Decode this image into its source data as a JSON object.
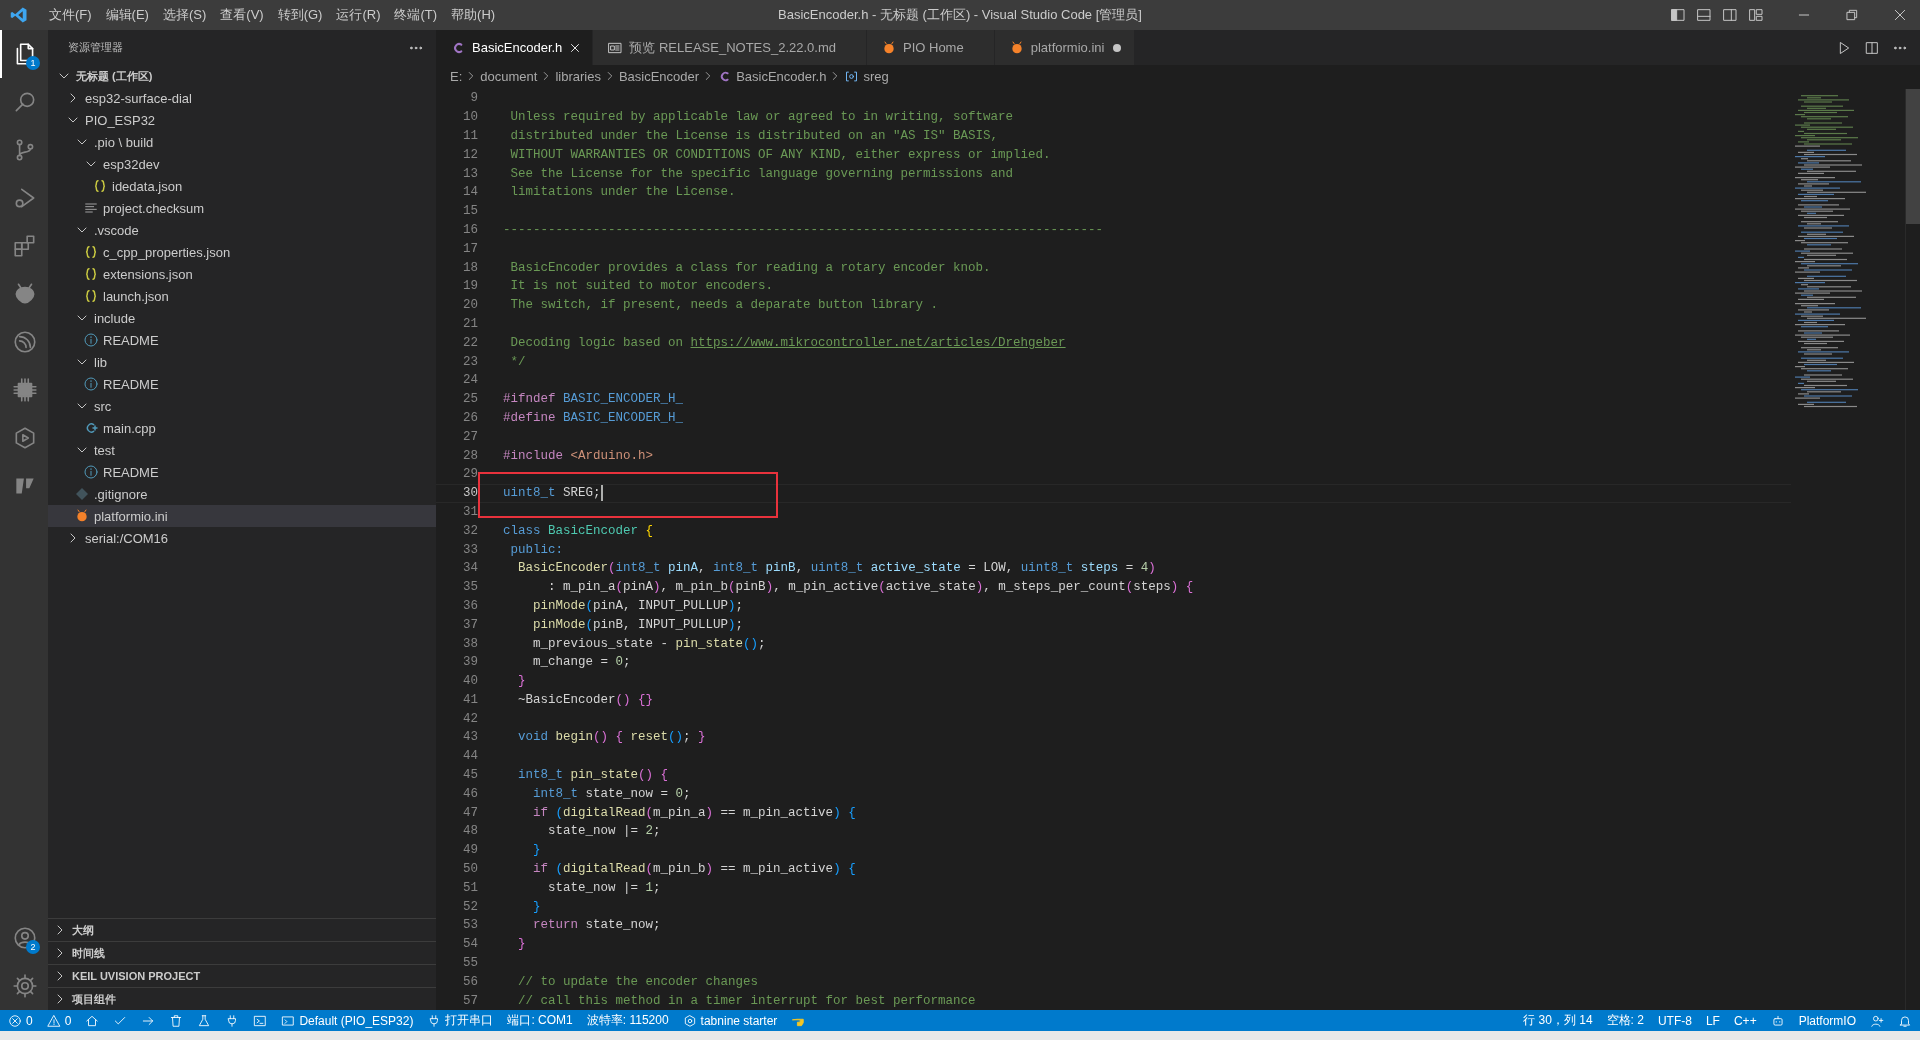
{
  "window": {
    "title": "BasicEncoder.h - 无标题 (工作区) - Visual Studio Code [管理员]",
    "menu": [
      "文件(F)",
      "编辑(E)",
      "选择(S)",
      "查看(V)",
      "转到(G)",
      "运行(R)",
      "终端(T)",
      "帮助(H)"
    ],
    "controls": [
      {
        "kind": "layout_left"
      },
      {
        "kind": "layout_panel"
      },
      {
        "kind": "layout_right"
      },
      {
        "kind": "layout_custom"
      },
      {
        "kind": "minimize"
      },
      {
        "kind": "restore"
      },
      {
        "kind": "close_win"
      }
    ]
  },
  "activity_bar": {
    "items": [
      {
        "kind": "files",
        "badge": "1",
        "selected": true
      },
      {
        "kind": "search",
        "selected": false
      },
      {
        "kind": "scm",
        "selected": false
      },
      {
        "kind": "debug",
        "selected": false
      },
      {
        "kind": "extensions",
        "selected": false
      },
      {
        "kind": "alien",
        "selected": false
      },
      {
        "kind": "espressif",
        "selected": false
      },
      {
        "kind": "chip",
        "selected": false
      },
      {
        "kind": "hexplay",
        "selected": false
      },
      {
        "kind": "flag",
        "selected": false
      }
    ],
    "bottom": [
      {
        "kind": "account",
        "badge": "2"
      },
      {
        "kind": "gear"
      }
    ]
  },
  "explorer": {
    "title": "资源管理器",
    "tree": [
      {
        "kind": "workspace",
        "label": "无标题 (工作区)",
        "expanded": true,
        "selected": false,
        "children": [
          {
            "kind": "folder",
            "label": "esp32-surface-dial",
            "expanded": false,
            "selected": false
          },
          {
            "kind": "folder",
            "label": "PIO_ESP32",
            "expanded": true,
            "selected": false,
            "children": [
              {
                "kind": "folder",
                "label": ".pio \\ build",
                "expanded": true,
                "selected": false,
                "children": [
                  {
                    "kind": "folder",
                    "label": "esp32dev",
                    "expanded": true,
                    "selected": false,
                    "children": [
                      {
                        "kind": "json",
                        "label": "idedata.json",
                        "selected": false
                      }
                    ]
                  },
                  {
                    "kind": "text",
                    "label": "project.checksum",
                    "selected": false
                  }
                ]
              },
              {
                "kind": "folder",
                "label": ".vscode",
                "expanded": true,
                "selected": false,
                "children": [
                  {
                    "kind": "json",
                    "label": "c_cpp_properties.json",
                    "selected": false
                  },
                  {
                    "kind": "json",
                    "label": "extensions.json",
                    "selected": false
                  },
                  {
                    "kind": "json",
                    "label": "launch.json",
                    "selected": false
                  }
                ]
              },
              {
                "kind": "folder",
                "label": "include",
                "expanded": true,
                "selected": false,
                "children": [
                  {
                    "kind": "info",
                    "label": "README",
                    "selected": false
                  }
                ]
              },
              {
                "kind": "folder",
                "label": "lib",
                "expanded": true,
                "selected": false,
                "children": [
                  {
                    "kind": "info",
                    "label": "README",
                    "selected": false
                  }
                ]
              },
              {
                "kind": "folder",
                "label": "src",
                "expanded": true,
                "selected": false,
                "children": [
                  {
                    "kind": "cpp",
                    "label": "main.cpp",
                    "selected": false
                  }
                ]
              },
              {
                "kind": "folder",
                "label": "test",
                "expanded": true,
                "selected": false,
                "children": [
                  {
                    "kind": "info",
                    "label": "README",
                    "selected": false
                  }
                ]
              },
              {
                "kind": "git",
                "label": ".gitignore",
                "selected": false
              },
              {
                "kind": "pio",
                "label": "platformio.ini",
                "selected": true
              }
            ]
          },
          {
            "kind": "folder",
            "label": "serial:/COM16",
            "expanded": false,
            "selected": false
          }
        ]
      }
    ],
    "sections": [
      {
        "label": "大纲",
        "expanded": false
      },
      {
        "label": "时间线",
        "expanded": false
      },
      {
        "label": "KEIL UVISION PROJECT",
        "expanded": false
      },
      {
        "label": "项目组件",
        "expanded": false
      }
    ]
  },
  "tabs": [
    {
      "label": "BasicEncoder.h",
      "kind": "c",
      "selected": true,
      "dirty": false
    },
    {
      "label": "预览 RELEASE_NOTES_2.22.0.md",
      "kind": "preview",
      "selected": false,
      "dirty": false
    },
    {
      "label": "PIO Home",
      "kind": "pio",
      "selected": false,
      "dirty": false
    },
    {
      "label": "platformio.ini",
      "kind": "pio",
      "selected": false,
      "dirty": true
    }
  ],
  "editor_actions": [
    {
      "kind": "run"
    },
    {
      "kind": "split"
    },
    {
      "kind": "more"
    }
  ],
  "breadcrumb": [
    {
      "label": "E:",
      "kind": "plain"
    },
    {
      "label": "document",
      "kind": "plain"
    },
    {
      "label": "libraries",
      "kind": "plain"
    },
    {
      "label": "BasicEncoder",
      "kind": "plain"
    },
    {
      "label": "BasicEncoder.h",
      "kind": "c"
    },
    {
      "label": "sreg",
      "kind": "symbol"
    }
  ],
  "editor": {
    "lines": [
      {
        "n": "9",
        "current": false
      },
      {
        "n": "10",
        "current": false,
        "tokens": [
          {
            "kind": "c",
            "t": " Unless required by applicable law or agreed to in writing, software"
          }
        ]
      },
      {
        "n": "11",
        "current": false,
        "tokens": [
          {
            "kind": "c",
            "t": " distributed under the License is distributed on an \"AS IS\" BASIS,"
          }
        ]
      },
      {
        "n": "12",
        "current": false,
        "tokens": [
          {
            "kind": "c",
            "t": " WITHOUT WARRANTIES OR CONDITIONS OF ANY KIND, either express or implied."
          }
        ]
      },
      {
        "n": "13",
        "current": false,
        "tokens": [
          {
            "kind": "c",
            "t": " See the License for the specific language governing permissions and"
          }
        ]
      },
      {
        "n": "14",
        "current": false,
        "tokens": [
          {
            "kind": "c",
            "t": " limitations under the License."
          }
        ]
      },
      {
        "n": "15",
        "current": false
      },
      {
        "n": "16",
        "current": false,
        "tokens": [
          {
            "kind": "c",
            "t": "--------------------------------------------------------------------------------"
          }
        ]
      },
      {
        "n": "17",
        "current": false
      },
      {
        "n": "18",
        "current": false,
        "tokens": [
          {
            "kind": "c",
            "t": " BasicEncoder provides a class for reading a rotary encoder knob."
          }
        ]
      },
      {
        "n": "19",
        "current": false,
        "tokens": [
          {
            "kind": "c",
            "t": " It is not suited to motor encoders."
          }
        ]
      },
      {
        "n": "20",
        "current": false,
        "tokens": [
          {
            "kind": "c",
            "t": " The switch, if present, needs a deparate button library ."
          }
        ]
      },
      {
        "n": "21",
        "current": false
      },
      {
        "n": "22",
        "current": false,
        "tokens": [
          {
            "kind": "c",
            "t": " Decoding logic based on "
          },
          {
            "kind": "link",
            "t": "https://www.mikrocontroller.net/articles/Drehgeber"
          }
        ]
      },
      {
        "n": "23",
        "current": false,
        "tokens": [
          {
            "kind": "c",
            "t": " */"
          }
        ]
      },
      {
        "n": "24",
        "current": false
      },
      {
        "n": "25",
        "current": false,
        "tokens": [
          {
            "kind": "ctrl",
            "t": "#ifndef"
          },
          {
            "kind": "kw",
            "t": " BASIC_ENCODER_H_"
          }
        ]
      },
      {
        "n": "26",
        "current": false,
        "tokens": [
          {
            "kind": "ctrl",
            "t": "#define"
          },
          {
            "kind": "kw",
            "t": " BASIC_ENCODER_H_"
          }
        ]
      },
      {
        "n": "27",
        "current": false
      },
      {
        "n": "28",
        "current": false,
        "tokens": [
          {
            "kind": "ctrl",
            "t": "#include"
          },
          {
            "kind": "str",
            "t": " <Arduino.h>"
          }
        ]
      },
      {
        "n": "29",
        "current": false
      },
      {
        "n": "30",
        "current": true,
        "tokens": [
          {
            "kind": "kw",
            "t": "uint8_t"
          },
          {
            "kind": "p",
            "t": " SREG;"
          }
        ]
      },
      {
        "n": "31",
        "current": false
      },
      {
        "n": "32",
        "current": false,
        "tokens": [
          {
            "kind": "kw",
            "t": "class"
          },
          {
            "kind": "type",
            "t": " BasicEncoder"
          },
          {
            "kind": "b1",
            "t": " {"
          }
        ]
      },
      {
        "n": "33",
        "current": false,
        "tokens": [
          {
            "kind": "kw",
            "t": " public:"
          }
        ]
      },
      {
        "n": "34",
        "current": false,
        "tokens": [
          {
            "kind": "fn",
            "t": "  BasicEncoder"
          },
          {
            "kind": "b2",
            "t": "("
          },
          {
            "kind": "kw",
            "t": "int8_t"
          },
          {
            "kind": "var",
            "t": " pinA"
          },
          {
            "kind": "p",
            "t": ", "
          },
          {
            "kind": "kw",
            "t": "int8_t"
          },
          {
            "kind": "var",
            "t": " pinB"
          },
          {
            "kind": "p",
            "t": ", "
          },
          {
            "kind": "kw",
            "t": "uint8_t"
          },
          {
            "kind": "var",
            "t": " active_state"
          },
          {
            "kind": "p",
            "t": " = LOW, "
          },
          {
            "kind": "kw",
            "t": "uint8_t"
          },
          {
            "kind": "var",
            "t": " steps"
          },
          {
            "kind": "p",
            "t": " = "
          },
          {
            "kind": "num",
            "t": "4"
          },
          {
            "kind": "b2",
            "t": ")"
          }
        ]
      },
      {
        "n": "35",
        "current": false,
        "tokens": [
          {
            "kind": "p",
            "t": "      : m_pin_a"
          },
          {
            "kind": "b2",
            "t": "("
          },
          {
            "kind": "p",
            "t": "pinA"
          },
          {
            "kind": "b2",
            "t": ")"
          },
          {
            "kind": "p",
            "t": ", m_pin_b"
          },
          {
            "kind": "b2",
            "t": "("
          },
          {
            "kind": "p",
            "t": "pinB"
          },
          {
            "kind": "b2",
            "t": ")"
          },
          {
            "kind": "p",
            "t": ", m_pin_active"
          },
          {
            "kind": "b2",
            "t": "("
          },
          {
            "kind": "p",
            "t": "active_state"
          },
          {
            "kind": "b2",
            "t": ")"
          },
          {
            "kind": "p",
            "t": ", m_steps_per_count"
          },
          {
            "kind": "b2",
            "t": "("
          },
          {
            "kind": "p",
            "t": "steps"
          },
          {
            "kind": "b2",
            "t": ")"
          },
          {
            "kind": "b2",
            "t": " {"
          }
        ]
      },
      {
        "n": "36",
        "current": false,
        "tokens": [
          {
            "kind": "fn",
            "t": "    pinMode"
          },
          {
            "kind": "b3",
            "t": "("
          },
          {
            "kind": "p",
            "t": "pinA, INPUT_PULLUP"
          },
          {
            "kind": "b3",
            "t": ")"
          },
          {
            "kind": "p",
            "t": ";"
          }
        ]
      },
      {
        "n": "37",
        "current": false,
        "tokens": [
          {
            "kind": "fn",
            "t": "    pinMode"
          },
          {
            "kind": "b3",
            "t": "("
          },
          {
            "kind": "p",
            "t": "pinB, INPUT_PULLUP"
          },
          {
            "kind": "b3",
            "t": ")"
          },
          {
            "kind": "p",
            "t": ";"
          }
        ]
      },
      {
        "n": "38",
        "current": false,
        "tokens": [
          {
            "kind": "p",
            "t": "    m_previous_state - "
          },
          {
            "kind": "fn",
            "t": "pin_state"
          },
          {
            "kind": "b3",
            "t": "()"
          },
          {
            "kind": "p",
            "t": ";"
          }
        ]
      },
      {
        "n": "39",
        "current": false,
        "tokens": [
          {
            "kind": "p",
            "t": "    m_change = "
          },
          {
            "kind": "num",
            "t": "0"
          },
          {
            "kind": "p",
            "t": ";"
          }
        ]
      },
      {
        "n": "40",
        "current": false,
        "tokens": [
          {
            "kind": "b2",
            "t": "  }"
          }
        ]
      },
      {
        "n": "41",
        "current": false,
        "tokens": [
          {
            "kind": "p",
            "t": "  ~BasicEncoder"
          },
          {
            "kind": "b2",
            "t": "()"
          },
          {
            "kind": "b2",
            "t": " {}"
          }
        ]
      },
      {
        "n": "42",
        "current": false
      },
      {
        "n": "43",
        "current": false,
        "tokens": [
          {
            "kind": "kw",
            "t": "  void"
          },
          {
            "kind": "fn",
            "t": " begin"
          },
          {
            "kind": "b2",
            "t": "()"
          },
          {
            "kind": "b2",
            "t": " {"
          },
          {
            "kind": "fn",
            "t": " reset"
          },
          {
            "kind": "b3",
            "t": "()"
          },
          {
            "kind": "p",
            "t": "; "
          },
          {
            "kind": "b2",
            "t": "}"
          }
        ]
      },
      {
        "n": "44",
        "current": false
      },
      {
        "n": "45",
        "current": false,
        "tokens": [
          {
            "kind": "kw",
            "t": "  int8_t"
          },
          {
            "kind": "fn",
            "t": " pin_state"
          },
          {
            "kind": "b2",
            "t": "()"
          },
          {
            "kind": "b2",
            "t": " {"
          }
        ]
      },
      {
        "n": "46",
        "current": false,
        "tokens": [
          {
            "kind": "kw",
            "t": "    int8_t"
          },
          {
            "kind": "p",
            "t": " state_now = "
          },
          {
            "kind": "num",
            "t": "0"
          },
          {
            "kind": "p",
            "t": ";"
          }
        ]
      },
      {
        "n": "47",
        "current": false,
        "tokens": [
          {
            "kind": "ctrl",
            "t": "    if"
          },
          {
            "kind": "b3",
            "t": " ("
          },
          {
            "kind": "fn",
            "t": "digitalRead"
          },
          {
            "kind": "b2",
            "t": "("
          },
          {
            "kind": "p",
            "t": "m_pin_a"
          },
          {
            "kind": "b2",
            "t": ")"
          },
          {
            "kind": "p",
            "t": " == m_pin_active"
          },
          {
            "kind": "b3",
            "t": ")"
          },
          {
            "kind": "b3",
            "t": " {"
          }
        ]
      },
      {
        "n": "48",
        "current": false,
        "tokens": [
          {
            "kind": "p",
            "t": "      state_now |= "
          },
          {
            "kind": "num",
            "t": "2"
          },
          {
            "kind": "p",
            "t": ";"
          }
        ]
      },
      {
        "n": "49",
        "current": false,
        "tokens": [
          {
            "kind": "b3",
            "t": "    }"
          }
        ]
      },
      {
        "n": "50",
        "current": false,
        "tokens": [
          {
            "kind": "ctrl",
            "t": "    if"
          },
          {
            "kind": "b3",
            "t": " ("
          },
          {
            "kind": "fn",
            "t": "digitalRead"
          },
          {
            "kind": "b2",
            "t": "("
          },
          {
            "kind": "p",
            "t": "m_pin_b"
          },
          {
            "kind": "b2",
            "t": ")"
          },
          {
            "kind": "p",
            "t": " == m_pin_active"
          },
          {
            "kind": "b3",
            "t": ")"
          },
          {
            "kind": "b3",
            "t": " {"
          }
        ]
      },
      {
        "n": "51",
        "current": false,
        "tokens": [
          {
            "kind": "p",
            "t": "      state_now |= "
          },
          {
            "kind": "num",
            "t": "1"
          },
          {
            "kind": "p",
            "t": ";"
          }
        ]
      },
      {
        "n": "52",
        "current": false,
        "tokens": [
          {
            "kind": "b3",
            "t": "    }"
          }
        ]
      },
      {
        "n": "53",
        "current": false,
        "tokens": [
          {
            "kind": "ctrl",
            "t": "    return"
          },
          {
            "kind": "p",
            "t": " state_now;"
          }
        ]
      },
      {
        "n": "54",
        "current": false,
        "tokens": [
          {
            "kind": "b2",
            "t": "  }"
          }
        ]
      },
      {
        "n": "55",
        "current": false
      },
      {
        "n": "56",
        "current": false,
        "tokens": [
          {
            "kind": "c",
            "t": "  // to update the encoder changes"
          }
        ]
      },
      {
        "n": "57",
        "current": false,
        "tokens": [
          {
            "kind": "c",
            "t": "  // call this method in a timer interrupt for best performance"
          }
        ]
      }
    ]
  },
  "status_bar": {
    "left": [
      {
        "kind": "error",
        "text": "0"
      },
      {
        "kind": "warning",
        "text": "0"
      },
      {
        "kind": "home"
      },
      {
        "kind": "check"
      },
      {
        "kind": "arrow"
      },
      {
        "kind": "trash"
      },
      {
        "kind": "flask"
      },
      {
        "kind": "plug"
      },
      {
        "kind": "terminal"
      },
      {
        "kind": "remote_folder",
        "text": "Default (PIO_ESP32)"
      },
      {
        "kind": "plug",
        "text": "打开串口"
      },
      {
        "kind": "none",
        "text": "端口: COM1"
      },
      {
        "kind": "none",
        "text": "波特率: 115200"
      },
      {
        "kind": "tabnine",
        "text": "tabnine starter"
      },
      {
        "kind": "hand"
      }
    ],
    "right": [
      {
        "kind": "none",
        "text": "行 30，列 14"
      },
      {
        "kind": "none",
        "text": "空格: 2"
      },
      {
        "kind": "none",
        "text": "UTF-8"
      },
      {
        "kind": "none",
        "text": "LF"
      },
      {
        "kind": "none",
        "text": "C++"
      },
      {
        "kind": "robot"
      },
      {
        "kind": "none",
        "text": "PlatformIO"
      },
      {
        "kind": "person"
      },
      {
        "kind": "bell"
      }
    ]
  }
}
